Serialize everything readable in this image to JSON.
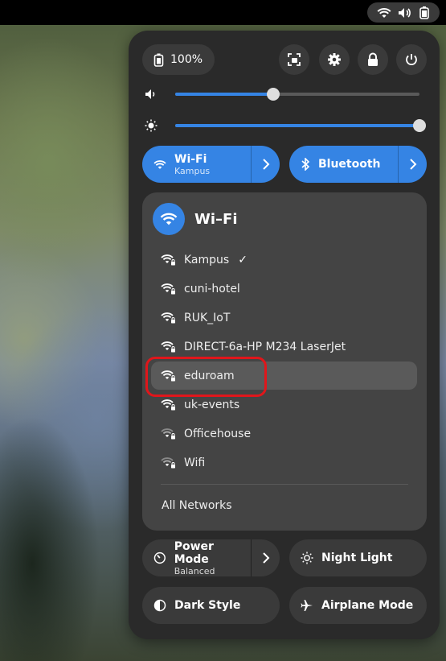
{
  "topbar": {
    "icons": [
      "wifi-icon",
      "volume-icon",
      "battery-icon"
    ]
  },
  "battery": {
    "label": "100%",
    "icon": "battery-full-icon"
  },
  "system_buttons": [
    "screenshot-icon",
    "settings-icon",
    "lock-icon",
    "power-icon"
  ],
  "sliders": {
    "volume": {
      "icon": "volume-icon",
      "level": 0.4
    },
    "brightness": {
      "icon": "brightness-icon",
      "level": 1.0
    }
  },
  "toggles": {
    "wifi": {
      "title": "Wi-Fi",
      "subtitle": "Kampus",
      "active": true
    },
    "bluetooth": {
      "title": "Bluetooth",
      "active": true
    },
    "power_mode": {
      "title": "Power Mode",
      "subtitle": "Balanced",
      "active": false
    },
    "night_light": {
      "title": "Night Light",
      "active": false
    },
    "dark_style": {
      "title": "Dark Style",
      "active": false
    },
    "airplane_mode": {
      "title": "Airplane Mode",
      "active": false
    }
  },
  "wifi_menu": {
    "title": "Wi–Fi",
    "networks": [
      {
        "name": "Kampus",
        "connected": true,
        "check": "✓"
      },
      {
        "name": "cuni-hotel"
      },
      {
        "name": "RUK_IoT"
      },
      {
        "name": "DIRECT-6a-HP M234 LaserJet"
      },
      {
        "name": "eduroam",
        "hover": true
      },
      {
        "name": "uk-events"
      },
      {
        "name": "Officehouse"
      },
      {
        "name": "Wifi"
      }
    ],
    "all_networks_label": "All Networks"
  },
  "colors": {
    "accent": "#3584e4",
    "panel": "#2a2a2a",
    "highlight": "#e0161b"
  }
}
